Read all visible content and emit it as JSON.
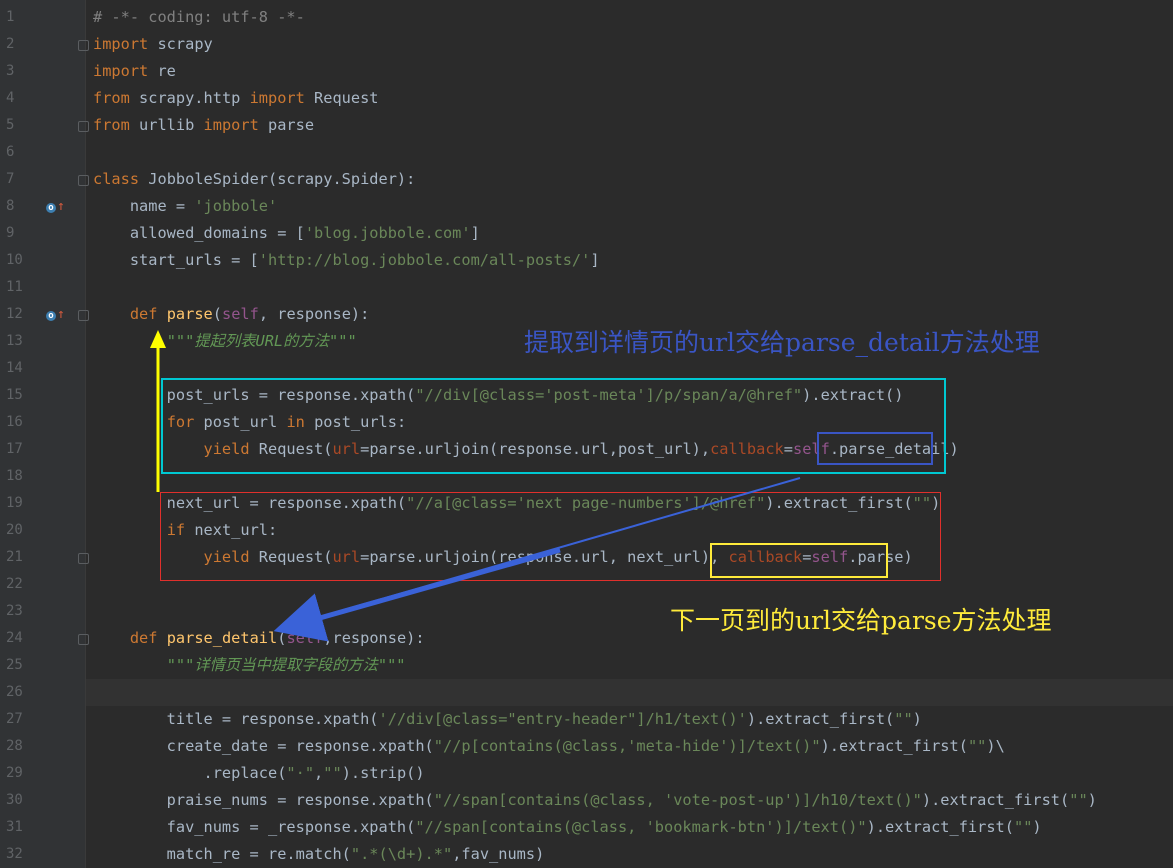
{
  "editor": {
    "lines": [
      {
        "n": "1",
        "html": "<span class=\"cm\"># -*- coding: utf-8 -*-</span>"
      },
      {
        "n": "2",
        "html": "<span class=\"kw\">import</span> scrapy"
      },
      {
        "n": "3",
        "html": "<span class=\"kw\">import</span> re"
      },
      {
        "n": "4",
        "html": "<span class=\"kw\">from</span> scrapy.http <span class=\"kw\">import</span> Request"
      },
      {
        "n": "5",
        "html": "<span class=\"kw\">from</span> urllib <span class=\"kw\">import</span> parse"
      },
      {
        "n": "6",
        "html": ""
      },
      {
        "n": "7",
        "html": "<span class=\"kw\">class</span> JobboleSpider(scrapy.Spider):"
      },
      {
        "n": "8",
        "html": "    name = <span class=\"str\">'jobbole'</span>"
      },
      {
        "n": "9",
        "html": "    allowed_domains = [<span class=\"str\">'blog.jobbole.com'</span>]"
      },
      {
        "n": "10",
        "html": "    start_urls = [<span class=\"str\">'http://blog.jobbole.com/all-posts/'</span>]"
      },
      {
        "n": "11",
        "html": ""
      },
      {
        "n": "12",
        "html": "    <span class=\"kw\">def</span> <span class=\"fn\">parse</span>(<span class=\"self\">self</span>, response):"
      },
      {
        "n": "13",
        "html": "        <span class=\"doc\">\"\"\"提起列表URL的方法\"\"\"</span>"
      },
      {
        "n": "14",
        "html": ""
      },
      {
        "n": "15",
        "html": "        post_urls = response.xpath(<span class=\"str\">\"//div[@class='post-meta']/p/span/a/@href\"</span>).extract()"
      },
      {
        "n": "16",
        "html": "        <span class=\"kw\">for</span> post_url <span class=\"kw\">in</span> post_urls:"
      },
      {
        "n": "17",
        "html": "            <span class=\"kw\">yield</span> Request(<span class=\"param\">url</span>=parse.urljoin(response.url,post_url),<span class=\"param\">callback</span>=<span class=\"self\">self</span>.parse_detail)"
      },
      {
        "n": "18",
        "html": ""
      },
      {
        "n": "19",
        "html": "        next_url = response.xpath(<span class=\"str\">\"//a[@class='next page-numbers']/@href\"</span>).extract_first(<span class=\"str\">\"\"</span>)"
      },
      {
        "n": "20",
        "html": "        <span class=\"kw\">if</span> next_url:"
      },
      {
        "n": "21",
        "html": "            <span class=\"kw\">yield</span> Request(<span class=\"param\">url</span>=parse.urljoin(response.url, next_url), <span class=\"param\">callback</span>=<span class=\"self\">self</span>.parse)"
      },
      {
        "n": "22",
        "html": ""
      },
      {
        "n": "23",
        "html": ""
      },
      {
        "n": "24",
        "html": "    <span class=\"kw\">def</span> <span class=\"fn\">parse_detail</span>(<span class=\"self\">self</span>,response):"
      },
      {
        "n": "25",
        "html": "        <span class=\"doc\">\"\"\"详情页当中提取字段的方法\"\"\"</span>"
      },
      {
        "n": "26",
        "html": ""
      },
      {
        "n": "27",
        "html": "        title = response.xpath(<span class=\"str\">'//div[@class=\"entry-header\"]/h1/text()'</span>).extract_first(<span class=\"str\">\"\"</span>)"
      },
      {
        "n": "28",
        "html": "        create_date = response.xpath(<span class=\"str\">\"//p[contains(@class,'meta-hide')]/text()\"</span>).extract_first(<span class=\"str\">\"\"</span>)\\"
      },
      {
        "n": "29",
        "html": "            .replace(<span class=\"str\">\"·\"</span>,<span class=\"str\">\"\"</span>).strip()"
      },
      {
        "n": "30",
        "html": "        praise_nums = response.xpath(<span class=\"str\">\"//span[contains(@class, 'vote-post-up')]/h10/text()\"</span>).extract_first(<span class=\"str\">\"\"</span>)"
      },
      {
        "n": "31",
        "html": "        fav_nums = _response.xpath(<span class=\"str\">\"//span[contains(@class, 'bookmark-btn')]/text()\"</span>).extract_first(<span class=\"str\">\"\"</span>)"
      },
      {
        "n": "32",
        "html": "        match_re = re.match(<span class=\"str\">\".*(\\d+).*\"</span>,fav_nums)"
      }
    ]
  },
  "annotations": {
    "detail_note": "提取到详情页的url交给parse_detail方法处理",
    "next_note": "下一页到的url交给parse方法处理"
  },
  "colors": {
    "background": "#2b2b2b",
    "gutter": "#313335",
    "keyword": "#cc7832",
    "string": "#6a8759",
    "cyan_box": "#00c8d2",
    "red_box": "#e0302c",
    "blue_box": "#3a55c4",
    "yellow_box": "#ffeb3b",
    "blue_arrow": "#3a62d8",
    "yellow_arrow": "#ffff00"
  }
}
